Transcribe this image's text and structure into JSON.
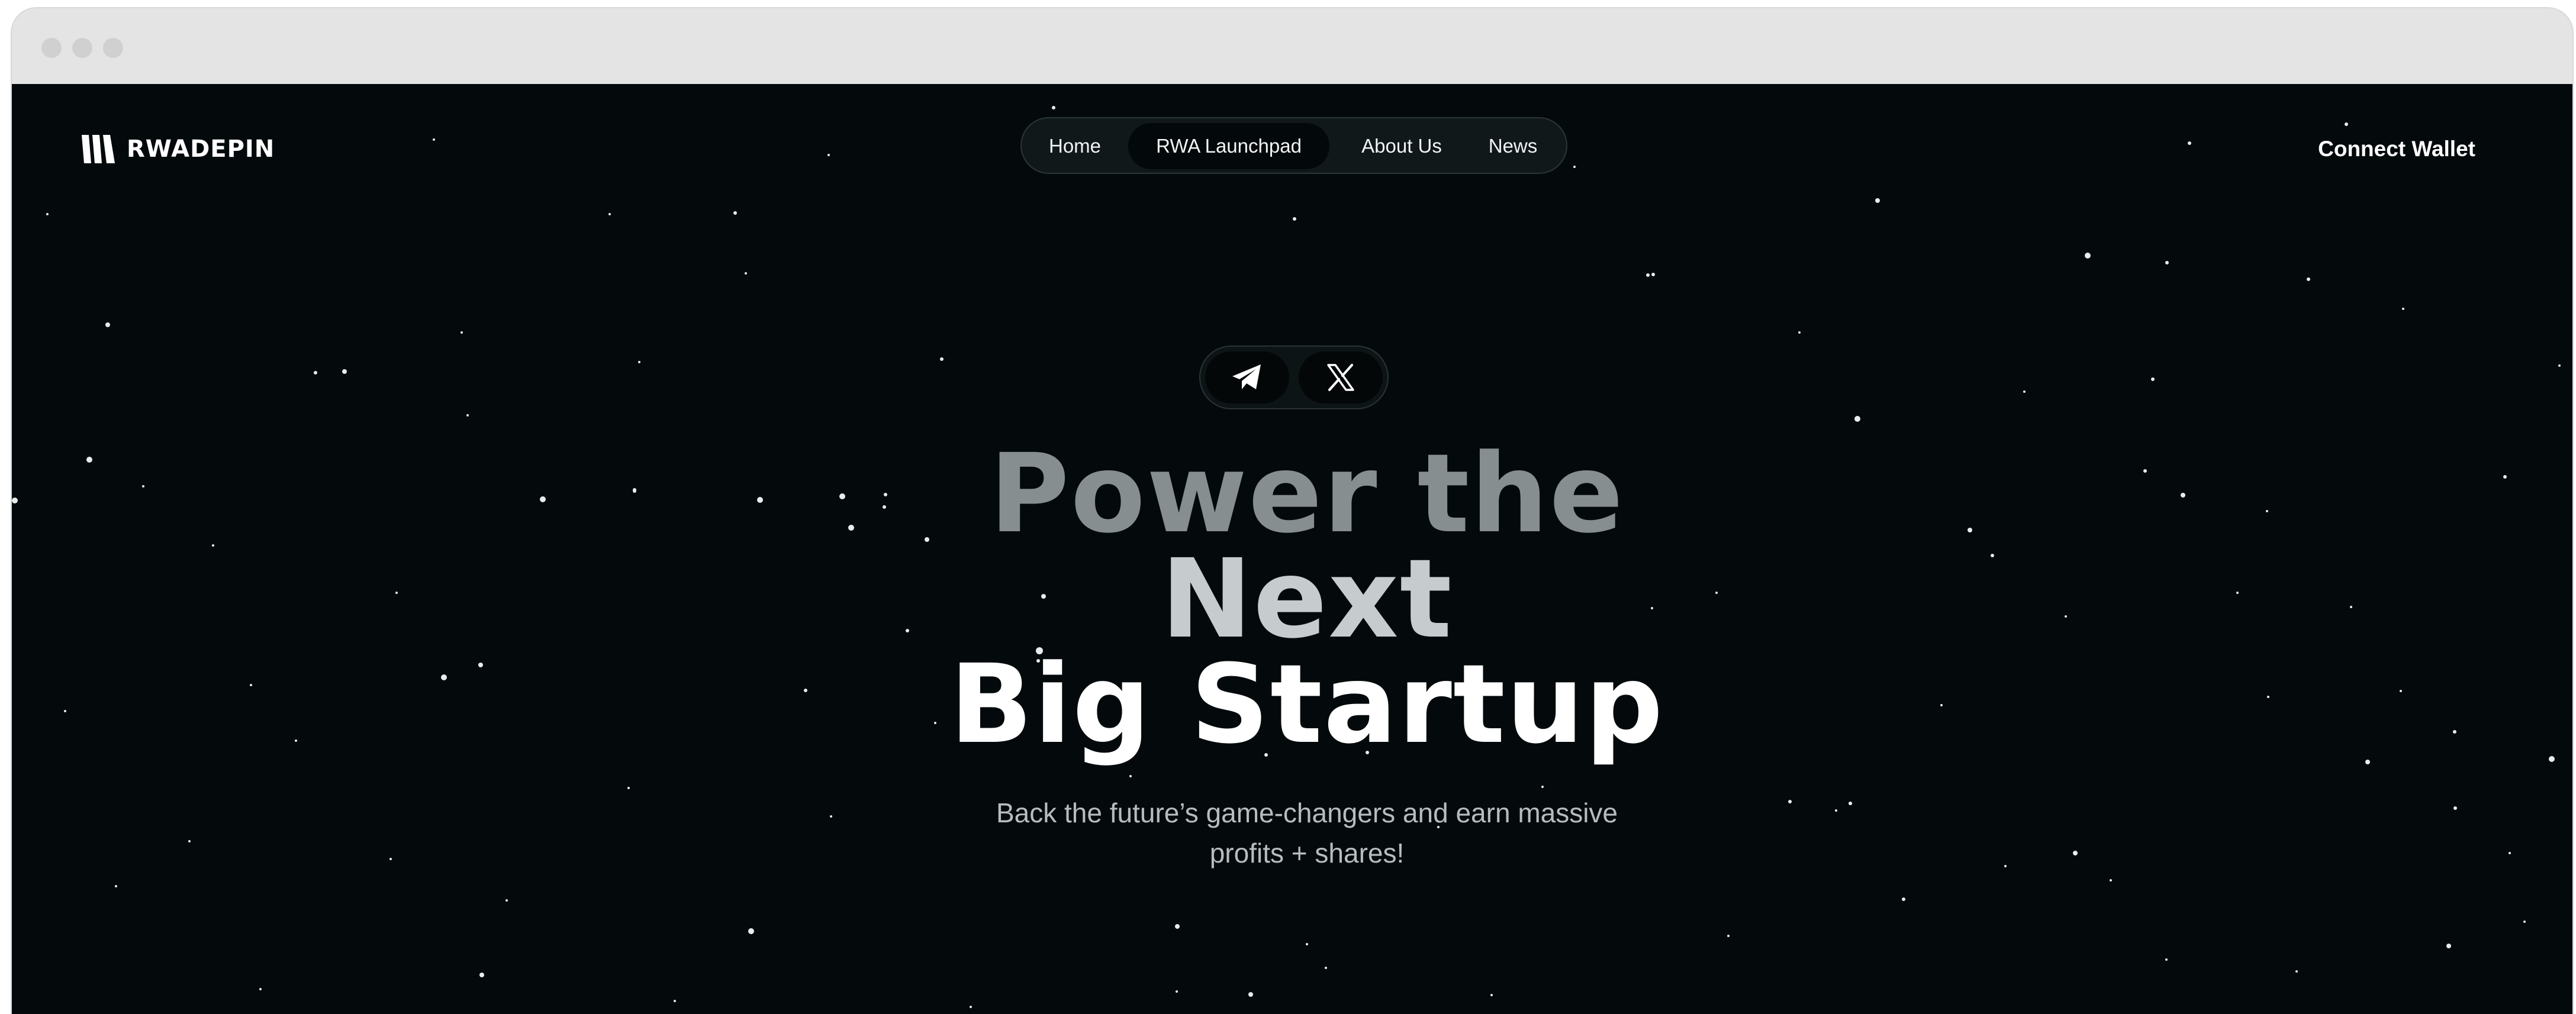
{
  "brand": {
    "name": "RWADEPIN"
  },
  "nav": {
    "items": [
      {
        "label": "Home"
      },
      {
        "label": "RWA Launchpad",
        "active": true
      },
      {
        "label": "About Us"
      },
      {
        "label": "News"
      }
    ]
  },
  "header": {
    "connect_label": "Connect Wallet"
  },
  "social": {
    "icons": [
      "telegram-icon",
      "x-icon"
    ]
  },
  "hero": {
    "line1": "Power the",
    "line2": "Next",
    "line3": "Big Startup",
    "subtitle_line1": "Back the future’s game-changers and earn massive",
    "subtitle_line2": "profits + shares!"
  },
  "colors": {
    "background": "#040a0c",
    "headline_dim": "#878e90",
    "headline_mid": "#c6cccd",
    "headline_bright": "#ffffff",
    "subtitle": "#b7bcbe"
  }
}
